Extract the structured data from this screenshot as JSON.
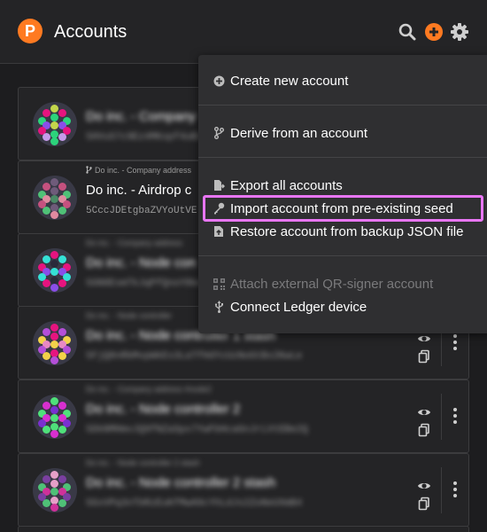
{
  "header": {
    "title": "Accounts",
    "logo_letter": "P",
    "icons": [
      "search-icon",
      "add-circle-icon",
      "gear-icon"
    ],
    "accent": "#ff7a21"
  },
  "accounts": [
    {
      "parent": "",
      "name": "Do inc. - Company",
      "address": "5HVuS7c9Ez4MKxpf4uB2Qz8hDqRrT",
      "blurred": true
    },
    {
      "parent": "Do inc. - Company address",
      "name": "Do inc. - Airdrop c",
      "address": "5CccJDEtgbaZVYoUtVE",
      "blurred": false
    },
    {
      "parent": "Do inc. - Company address",
      "name": "Do inc. - Node con",
      "address": "5GN8EsmTkJqPfQnoY8kd7aBcZtvE",
      "blurred": true
    },
    {
      "parent": "Do inc. - Node controller",
      "name": "Do inc. - Node controller 1 stash",
      "address": "5FjQ8nRbMvpWkEs3LaTfHdYcUzNoGtBx2KwLe",
      "blurred": true
    },
    {
      "parent": "Do inc. - Company address #node2",
      "name": "Do inc. - Node controller 2",
      "address": "5DkNMHmvJQ9fNZaSpx7YwFbHcaGnJrLVtEBe2Q",
      "blurred": true
    },
    {
      "parent": "Do inc. - Node controller 2 stash",
      "name": "Do inc. - Node controller 2 stash",
      "address": "5GxVPq3nTbRzEuKfMwA9cYhLdJs2ZoNeUXmB4",
      "blurred": true
    }
  ],
  "menu": {
    "items": [
      {
        "label": "Create new account",
        "icon": "plus-circle-icon"
      },
      {
        "label": "Derive from an account",
        "icon": "code-branch-icon"
      },
      {
        "label": "Export all accounts",
        "icon": "file-export-icon"
      },
      {
        "label": "Import account from pre-existing seed",
        "icon": "key-icon",
        "highlighted": true
      },
      {
        "label": "Restore account from backup JSON file",
        "icon": "file-upload-icon"
      },
      {
        "label": "Attach external QR-signer account",
        "icon": "qrcode-icon",
        "disabled": true
      },
      {
        "label": "Connect Ledger device",
        "icon": "usb-icon"
      }
    ],
    "highlight_color": "#e876f5"
  }
}
